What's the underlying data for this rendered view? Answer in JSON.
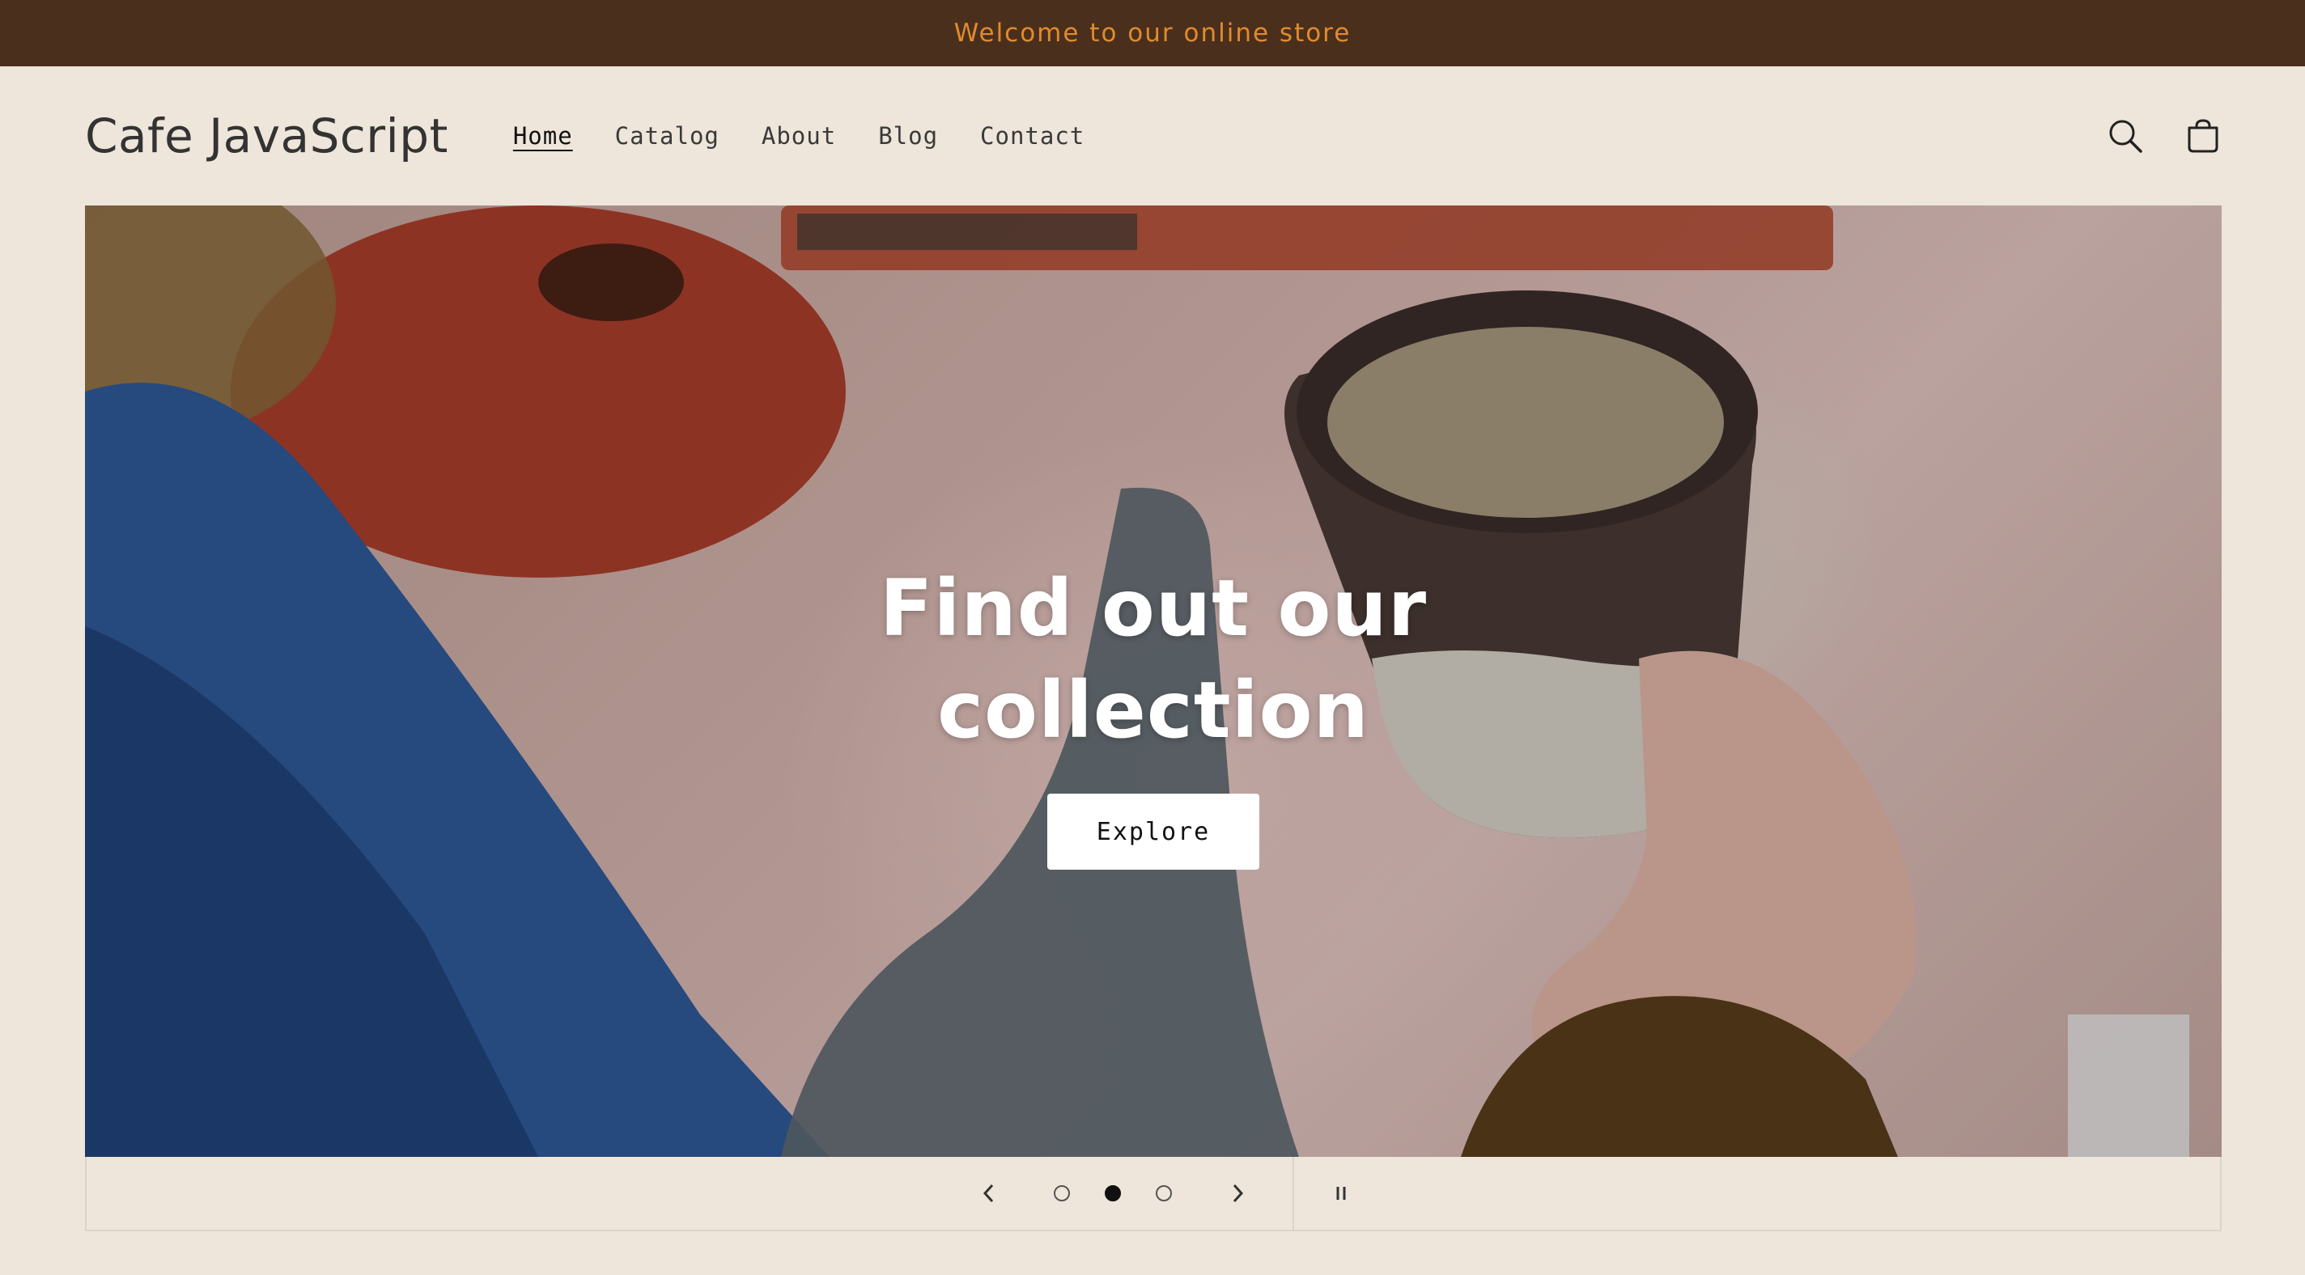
{
  "announcement": {
    "text": "Welcome to our online store"
  },
  "header": {
    "logo": "Cafe JavaScript",
    "nav": [
      {
        "label": "Home",
        "active": true
      },
      {
        "label": "Catalog",
        "active": false
      },
      {
        "label": "About",
        "active": false
      },
      {
        "label": "Blog",
        "active": false
      },
      {
        "label": "Contact",
        "active": false
      }
    ],
    "icons": [
      "search-icon",
      "cart-icon"
    ]
  },
  "hero": {
    "title": "Find out our collection",
    "button_label": "Explore"
  },
  "slider": {
    "slide_count": 3,
    "active_slide": 2,
    "icons": [
      "chevron-left-icon",
      "chevron-right-icon",
      "pause-icon"
    ]
  },
  "colors": {
    "announcement_bg": "#4A301C",
    "announcement_text": "#E28A2E",
    "page_bg": "#EEE5DB"
  }
}
